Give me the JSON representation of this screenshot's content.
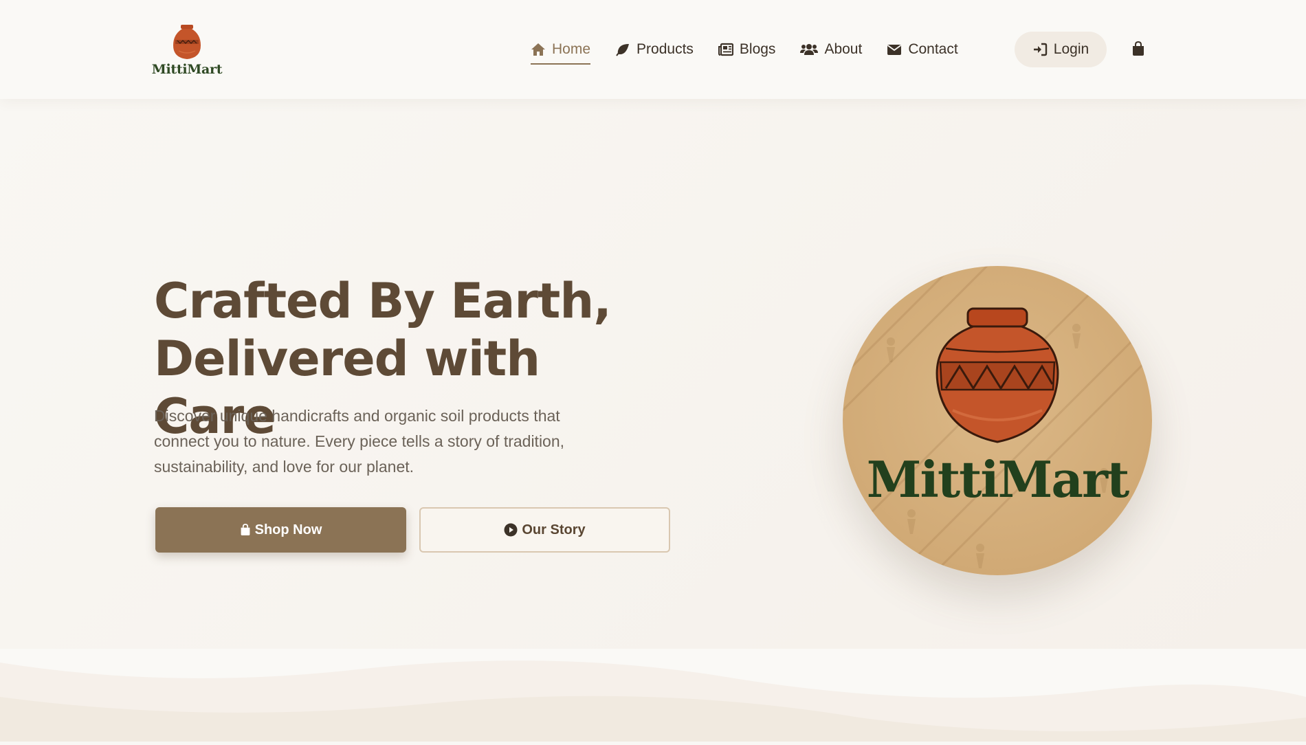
{
  "brand": {
    "name": "MittiMart",
    "colors": {
      "primary": "#8b7355",
      "heading": "#5e4a36",
      "logo_green": "#22401d",
      "terracotta": "#c2552a"
    }
  },
  "nav": {
    "items": [
      {
        "label": "Home",
        "icon": "home-icon",
        "active": true
      },
      {
        "label": "Products",
        "icon": "leaf-icon",
        "active": false
      },
      {
        "label": "Blogs",
        "icon": "newspaper-icon",
        "active": false
      },
      {
        "label": "About",
        "icon": "users-icon",
        "active": false
      },
      {
        "label": "Contact",
        "icon": "envelope-icon",
        "active": false
      }
    ],
    "login_label": "Login",
    "login_icon": "sign-in-icon",
    "cart_icon": "shopping-bag-icon"
  },
  "hero": {
    "title_line1": "Crafted By Earth,",
    "title_line2": "Delivered with Care",
    "description": "Discover unique handicrafts and organic soil products that connect you to nature. Every piece tells a story of tradition, sustainability, and love for our planet.",
    "primary_button": "Shop Now",
    "primary_icon": "shopping-bag-icon",
    "secondary_button": "Our Story",
    "secondary_icon": "play-circle-icon",
    "image_logo_text": "MittiMart"
  }
}
